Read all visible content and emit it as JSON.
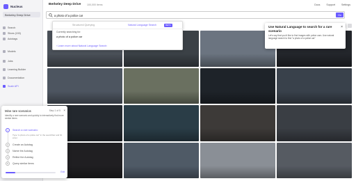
{
  "app": {
    "brand": "Nucleus",
    "dataset": "Berkeley Deep Drive",
    "title": "Berkeley Deep Drive",
    "subtitle": "100,000 items",
    "top_links": [
      "Docs",
      "Support",
      "Settings"
    ]
  },
  "sidebar": {
    "items": [
      {
        "label": "Search",
        "icon": "search-icon"
      },
      {
        "label": "Slices (153)",
        "icon": "slice-icon"
      },
      {
        "label": "Autotags",
        "icon": "tag-icon"
      },
      {
        "label": "Models",
        "icon": "model-icon"
      },
      {
        "label": "Jobs",
        "icon": "jobs-icon"
      },
      {
        "label": "Learning Builder",
        "icon": "builder-icon"
      },
      {
        "label": "Documentation",
        "icon": "doc-icon"
      },
      {
        "label": "Scale API",
        "icon": "api-icon"
      }
    ]
  },
  "search": {
    "value": "a photo of a police car",
    "button_label": "Go"
  },
  "dropdown": {
    "structured_label": "Structured Querying",
    "nls_label": "Natural Language Search",
    "beta": "BETA",
    "searching_for_label": "Currently searching for:",
    "searching_for_value": "a photo of a police car",
    "learn_more": "Learn more about Natural Language Search"
  },
  "tooltip": {
    "title": "Use Natural Language to search for a rare scenario",
    "body": "Let's say that you'd like to find images with police cars. Use natural language search to find \"a photo of a police car\"",
    "close": "×"
  },
  "scenario_panel": {
    "title": "Mine rare scenarios",
    "step_counter": "Step 1 of 5",
    "intro": "Identify a rare scenario and quickly to interactively find more similar items",
    "steps": [
      {
        "num": "1",
        "label": "Search a rare scenario"
      },
      {
        "num": "2",
        "label": "Create an Autotag"
      },
      {
        "num": "3",
        "label": "Name the Autotag"
      },
      {
        "num": "4",
        "label": "Refine the Autotag"
      },
      {
        "num": "5",
        "label": "Query similar items"
      }
    ],
    "active_step_desc": "Type \"a photo of a police car\" in the searchbar and hit enter.",
    "progress": 0.2,
    "exit_label": "Exit",
    "close": "×"
  },
  "grid": {
    "tiles": [
      {
        "color": "#4a5058"
      },
      {
        "color": "#3b4146"
      },
      {
        "color": "#6b7480"
      },
      {
        "color": "#23262b"
      },
      {
        "color": "#4d5560"
      },
      {
        "color": "#6a7060"
      },
      {
        "color": "#1e2329"
      },
      {
        "color": "#39414b"
      },
      {
        "color": "#23282e"
      },
      {
        "color": "#2a3d47"
      },
      {
        "color": "#3d3a38"
      },
      {
        "color": "#3a3e44"
      },
      {
        "color": "#201f22"
      },
      {
        "color": "#4f5a66"
      },
      {
        "color": "#8a8f96"
      },
      {
        "color": "#565b62"
      }
    ]
  },
  "colors": {
    "accent": "#6b5cff"
  }
}
